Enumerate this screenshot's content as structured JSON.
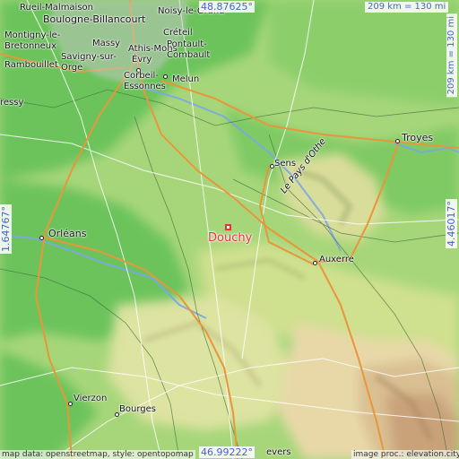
{
  "map": {
    "target": {
      "name": "Douchy",
      "marker_color": "#e8333a"
    },
    "places": [
      {
        "id": "rueil",
        "name": "Rueil-Malmaison"
      },
      {
        "id": "noisy",
        "name": "Noisy-le-Grand"
      },
      {
        "id": "boulogne",
        "name": "Boulogne-Billancourt"
      },
      {
        "id": "montigny",
        "name": "Montigny-le-Bretonneux"
      },
      {
        "id": "creteil",
        "name": "Créteil"
      },
      {
        "id": "massy",
        "name": "Massy"
      },
      {
        "id": "athis",
        "name": "Athis-Mons"
      },
      {
        "id": "pontault",
        "name": "Pontault-Combault"
      },
      {
        "id": "savigny",
        "name": "Savigny-sur-Orge"
      },
      {
        "id": "evry",
        "name": "Évry"
      },
      {
        "id": "rambouillet",
        "name": "Rambouillet"
      },
      {
        "id": "corbeil",
        "name": "Corbeil-Essonnes"
      },
      {
        "id": "melun",
        "name": "Melun"
      },
      {
        "id": "sens",
        "name": "Sens"
      },
      {
        "id": "troyes",
        "name": "Troyes"
      },
      {
        "id": "orleans",
        "name": "Orléans"
      },
      {
        "id": "auxerre",
        "name": "Auxerre"
      },
      {
        "id": "pays_othe",
        "name": "Le Pays d'Othe"
      },
      {
        "id": "vierzon",
        "name": "Vierzon"
      },
      {
        "id": "bourges",
        "name": "Bourges"
      },
      {
        "id": "nevers",
        "name": "evers"
      },
      {
        "id": "ressy",
        "name": "ressy"
      }
    ],
    "coordinates": {
      "top": "48.87625°",
      "bottom": "46.99222°",
      "left": "1.64767°",
      "right": "4.46017°"
    },
    "scale": {
      "horizontal": "209 km = 130 mi",
      "vertical": "209 km = 130 mi"
    },
    "credits": {
      "left": "map data: openstreetmap, style: opentopomap",
      "right": "image proc.: elevation.city"
    },
    "colors": {
      "lowland": "#6cc35c",
      "plain": "#a7d67a",
      "hills": "#d9dd9a",
      "upland": "#e8d8a8",
      "highland": "#d2b48c",
      "road_major": "#e8963a",
      "road_minor": "#ffffff",
      "water": "#7aa7e8",
      "accent_text": "#4a5fd0",
      "target": "#e8333a"
    }
  }
}
